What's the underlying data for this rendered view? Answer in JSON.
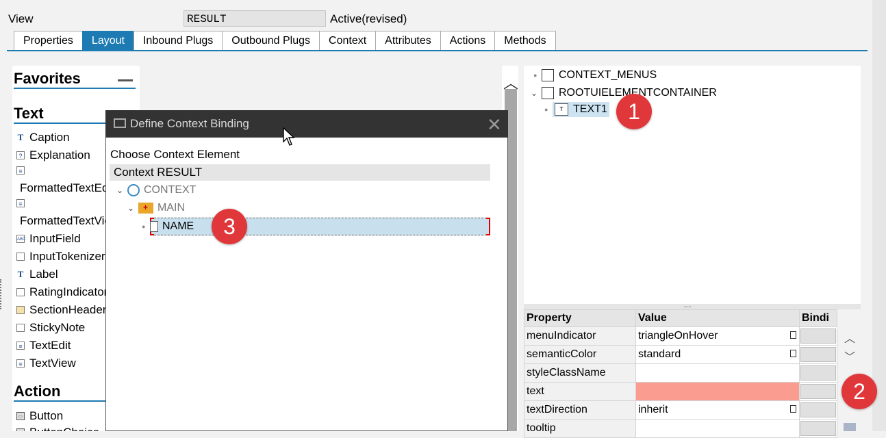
{
  "header": {
    "view_label": "View",
    "view_name": "RESULT",
    "status": "Active(revised)"
  },
  "tabs": [
    {
      "label": "Properties",
      "active": false
    },
    {
      "label": "Layout",
      "active": true
    },
    {
      "label": "Inbound Plugs",
      "active": false
    },
    {
      "label": "Outbound Plugs",
      "active": false
    },
    {
      "label": "Context",
      "active": false
    },
    {
      "label": "Attributes",
      "active": false
    },
    {
      "label": "Actions",
      "active": false
    },
    {
      "label": "Methods",
      "active": false
    }
  ],
  "palette": {
    "favorites_title": "Favorites",
    "text_title": "Text",
    "text_items": [
      "Caption",
      "Explanation",
      "FormattedTextEdit",
      "FormattedTextView",
      "InputField",
      "InputTokenizer",
      "Label",
      "RatingIndicator",
      "SectionHeader",
      "StickyNote",
      "TextEdit",
      "TextView"
    ],
    "action_title": "Action",
    "action_items": [
      "Button",
      "ButtonChoice"
    ]
  },
  "tree": {
    "items": [
      {
        "label": "CONTEXT_MENUS"
      },
      {
        "label": "ROOTUIELEMENTCONTAINER"
      },
      {
        "label": "TEXT1",
        "selected": true
      }
    ]
  },
  "properties": {
    "headers": [
      "Property",
      "Value",
      "Bindi"
    ],
    "rows": [
      {
        "name": "menuIndicator",
        "value": "triangleOnHover",
        "has_icon": true
      },
      {
        "name": "semanticColor",
        "value": "standard",
        "has_icon": true
      },
      {
        "name": "styleClassName",
        "value": "",
        "has_icon": false
      },
      {
        "name": "text",
        "value": "",
        "has_icon": false,
        "error": true
      },
      {
        "name": "textDirection",
        "value": "inherit",
        "has_icon": true
      },
      {
        "name": "tooltip",
        "value": "",
        "has_icon": false
      }
    ]
  },
  "dialog": {
    "title": "Define Context Binding",
    "choose_label": "Choose Context Element",
    "context_header": "Context RESULT",
    "nodes": [
      "CONTEXT",
      "MAIN",
      "NAME"
    ]
  },
  "badges": [
    "1",
    "2",
    "3"
  ],
  "colors": {
    "accent": "#1d7ab3",
    "error_field": "#fb9c91",
    "badge": "#e0373b",
    "selection": "#cde3f2"
  }
}
